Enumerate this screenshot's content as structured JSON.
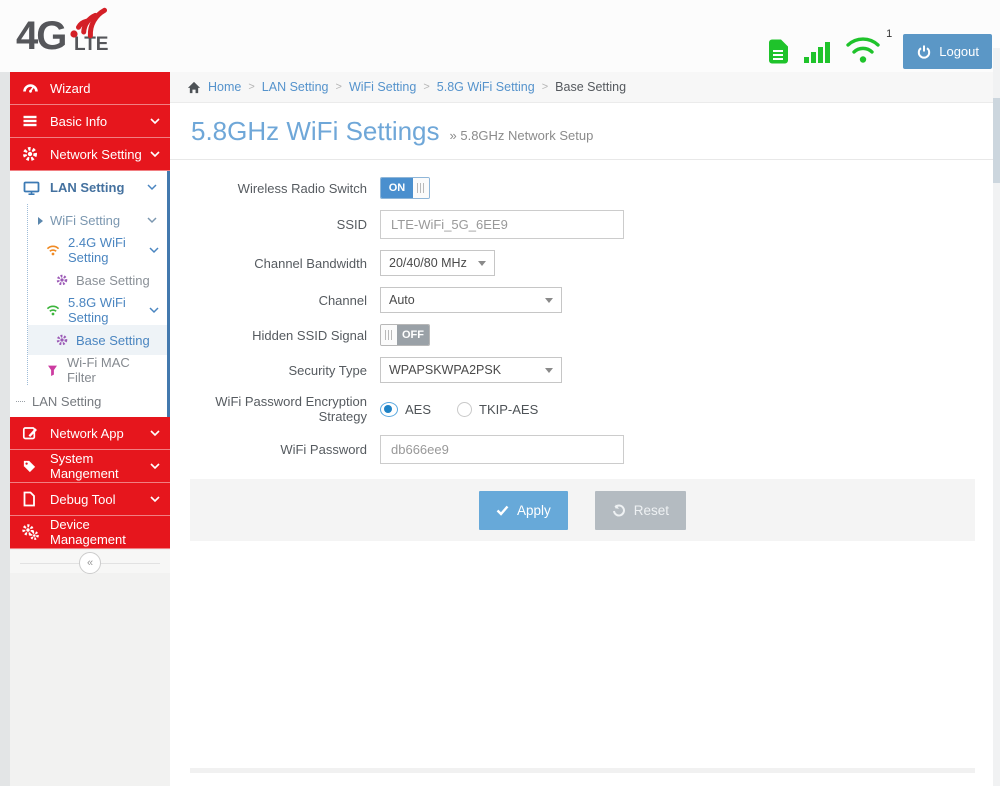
{
  "colors": {
    "accent_red": "#e6161d",
    "accent_blue": "#4a8fce",
    "link_blue": "#5593cc",
    "title_blue": "#6fa7d8",
    "status_green": "#1fc32b",
    "gear_purple": "#9b59b6",
    "wifi_orange": "#f08a24",
    "wifi_green": "#3db53d",
    "filter_pink": "#cc3ba0"
  },
  "header": {
    "logo_main": "4G",
    "logo_sub": "LTE",
    "wifi_badge": "1",
    "logout_label": "Logout"
  },
  "sidebar": {
    "items": [
      {
        "label": "Wizard"
      },
      {
        "label": "Basic Info"
      },
      {
        "label": "Network Setting"
      },
      {
        "label": "LAN Setting"
      },
      {
        "label": "WiFi Setting"
      },
      {
        "label": "2.4G WiFi Setting"
      },
      {
        "label": "Base Setting"
      },
      {
        "label": "5.8G WiFi Setting"
      },
      {
        "label": "Base Setting"
      },
      {
        "label": "Wi-Fi MAC Filter"
      },
      {
        "label": "LAN Setting"
      },
      {
        "label": "Network App"
      },
      {
        "label": "System Mangement"
      },
      {
        "label": "Debug Tool"
      },
      {
        "label": "Device Management"
      }
    ],
    "collapse_icon": "«"
  },
  "breadcrumb": {
    "home": "Home",
    "sep": ">",
    "crumbs": [
      "LAN Setting",
      "WiFi Setting",
      "5.8G WiFi Setting",
      "Base Setting"
    ]
  },
  "page": {
    "title": "5.8GHz WiFi Settings",
    "subtitle": "» 5.8GHz Network Setup"
  },
  "form": {
    "wireless_radio": {
      "label": "Wireless Radio Switch",
      "state": "ON"
    },
    "ssid": {
      "label": "SSID",
      "value": "LTE-WiFi_5G_6EE9"
    },
    "channel_bandwidth": {
      "label": "Channel Bandwidth",
      "value": "20/40/80 MHz"
    },
    "channel": {
      "label": "Channel",
      "value": "Auto"
    },
    "hidden_ssid": {
      "label": "Hidden SSID Signal",
      "state": "OFF"
    },
    "security_type": {
      "label": "Security Type",
      "value": "WPAPSKWPA2PSK"
    },
    "encryption": {
      "label": "WiFi Password Encryption Strategy",
      "option1": "AES",
      "option2": "TKIP-AES"
    },
    "wifi_password": {
      "label": "WiFi Password",
      "value": "db666ee9"
    }
  },
  "actions": {
    "apply_label": "Apply",
    "reset_label": "Reset"
  }
}
